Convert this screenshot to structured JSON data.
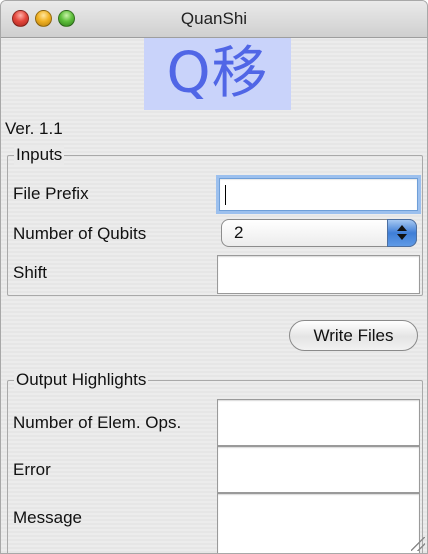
{
  "window": {
    "title": "QuanShi"
  },
  "logo": {
    "text": "Q移"
  },
  "version": "Ver. 1.1",
  "inputs": {
    "legend": "Inputs",
    "file_prefix": {
      "label": "File Prefix",
      "value": ""
    },
    "num_qubits": {
      "label": "Number of Qubits",
      "selected": "2"
    },
    "shift": {
      "label": "Shift",
      "value": ""
    }
  },
  "write_button": "Write Files",
  "outputs": {
    "legend": "Output Highlights",
    "elem_ops": {
      "label": "Number of Elem. Ops.",
      "value": ""
    },
    "error": {
      "label": "Error",
      "value": ""
    },
    "message": {
      "label": "Message",
      "value": ""
    }
  },
  "colors": {
    "logo_background": "#c9d3fa",
    "logo_text": "#5066e6",
    "focus_ring": "#9cc0ee"
  }
}
